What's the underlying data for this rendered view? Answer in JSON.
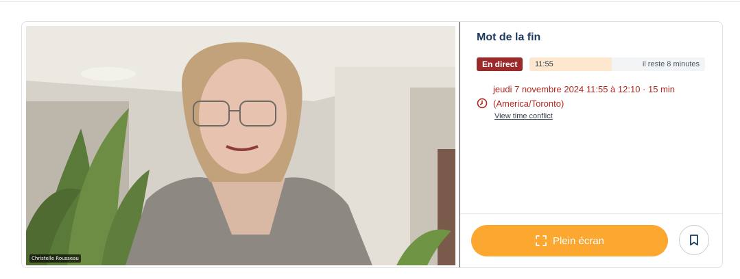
{
  "video": {
    "participant_name": "Christelle Rousseau"
  },
  "session": {
    "title": "Mot de la fin",
    "live_label": "En direct",
    "current_time": "11:55",
    "remaining_text": "il reste 8 minutes",
    "progress_fraction": 0.47,
    "date_line": "jeudi 7 novembre 2024 11:55 à 12:10 · 15 min",
    "timezone_line": "(America/Toronto)",
    "conflict_link": "View time conflict"
  },
  "actions": {
    "fullscreen_label": "Plein écran",
    "fullscreen_icon": "expand-corners-icon",
    "bookmark_icon": "bookmark-icon"
  },
  "colors": {
    "title": "#1e3a5f",
    "live_badge": "#9b2a2a",
    "progress_fill": "#fde7cf",
    "date_text": "#b3261e",
    "fullscreen_button": "#fba730"
  }
}
